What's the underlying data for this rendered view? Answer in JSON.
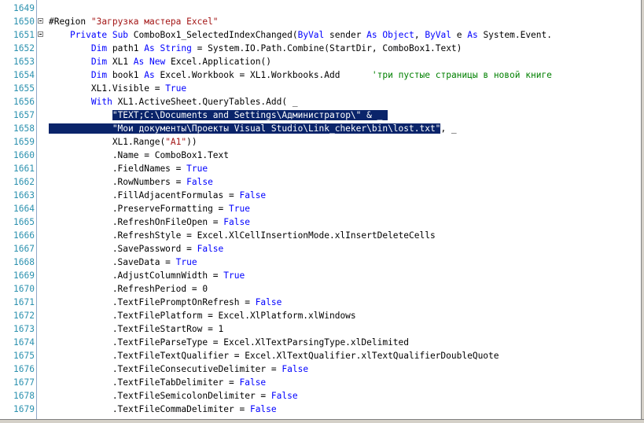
{
  "lines": [
    {
      "n": "1649",
      "t": ""
    },
    {
      "n": "1650",
      "fold": "open",
      "html": "#Region <span class=\"str\">\"Загрузка мастера Excel\"</span>"
    },
    {
      "n": "1651",
      "fold": "open",
      "html": "    <span class=\"kw\">Private Sub</span> ComboBox1_SelectedIndexChanged(<span class=\"kw\">ByVal</span> sender <span class=\"kw\">As</span> <span class=\"kw\">Object</span>, <span class=\"kw\">ByVal</span> e <span class=\"kw\">As</span> System.Event."
    },
    {
      "n": "1652",
      "html": "        <span class=\"kw\">Dim</span> path1 <span class=\"kw\">As String</span> = System.IO.Path.Combine(StartDir, ComboBox1.Text)"
    },
    {
      "n": "1653",
      "html": "        <span class=\"kw\">Dim</span> XL1 <span class=\"kw\">As New</span> Excel.Application()"
    },
    {
      "n": "1654",
      "html": "        <span class=\"kw\">Dim</span> book1 <span class=\"kw\">As</span> Excel.Workbook = XL1.Workbooks.Add      <span class=\"cmt\">'три пустые страницы в новой книге</span>"
    },
    {
      "n": "1655",
      "html": "        XL1.Visible = <span class=\"kw\">True</span>"
    },
    {
      "n": "1656",
      "html": "        <span class=\"kw\">With</span> XL1.ActiveSheet.QueryTables.Add( _"
    },
    {
      "n": "1657",
      "html": "            <span class=\"sel\">\"TEXT;C:\\Documents and Settings\\Администратор\\\" &amp; _ </span>"
    },
    {
      "n": "1658",
      "html": "<span class=\"sel\">            \"Мои документы\\Проекты Visual Studio\\Link_cheker\\bin\\lost.txt\"</span>, _"
    },
    {
      "n": "1659",
      "html": "            XL1.Range(<span class=\"str\">\"A1\"</span>))"
    },
    {
      "n": "1660",
      "html": "            .Name = ComboBox1.Text"
    },
    {
      "n": "1661",
      "html": "            .FieldNames = <span class=\"kw\">True</span>"
    },
    {
      "n": "1662",
      "html": "            .RowNumbers = <span class=\"kw\">False</span>"
    },
    {
      "n": "1663",
      "html": "            .FillAdjacentFormulas = <span class=\"kw\">False</span>"
    },
    {
      "n": "1664",
      "html": "            .PreserveFormatting = <span class=\"kw\">True</span>"
    },
    {
      "n": "1665",
      "html": "            .RefreshOnFileOpen = <span class=\"kw\">False</span>"
    },
    {
      "n": "1666",
      "html": "            .RefreshStyle = Excel.XlCellInsertionMode.xlInsertDeleteCells"
    },
    {
      "n": "1667",
      "html": "            .SavePassword = <span class=\"kw\">False</span>"
    },
    {
      "n": "1668",
      "html": "            .SaveData = <span class=\"kw\">True</span>"
    },
    {
      "n": "1669",
      "html": "            .AdjustColumnWidth = <span class=\"kw\">True</span>"
    },
    {
      "n": "1670",
      "html": "            .RefreshPeriod = 0"
    },
    {
      "n": "1671",
      "html": "            .TextFilePromptOnRefresh = <span class=\"kw\">False</span>"
    },
    {
      "n": "1672",
      "html": "            .TextFilePlatform = Excel.XlPlatform.xlWindows"
    },
    {
      "n": "1673",
      "html": "            .TextFileStartRow = 1"
    },
    {
      "n": "1674",
      "html": "            .TextFileParseType = Excel.XlTextParsingType.xlDelimited"
    },
    {
      "n": "1675",
      "html": "            .TextFileTextQualifier = Excel.XlTextQualifier.xlTextQualifierDoubleQuote"
    },
    {
      "n": "1676",
      "html": "            .TextFileConsecutiveDelimiter = <span class=\"kw\">False</span>"
    },
    {
      "n": "1677",
      "html": "            .TextFileTabDelimiter = <span class=\"kw\">False</span>"
    },
    {
      "n": "1678",
      "html": "            .TextFileSemicolonDelimiter = <span class=\"kw\">False</span>"
    },
    {
      "n": "1679",
      "html": "            .TextFileCommaDelimiter = <span class=\"kw\">False</span>"
    }
  ],
  "colors": {
    "keyword": "#0000ff",
    "string": "#a31515",
    "comment": "#008000",
    "selection": "#0a246a",
    "line_number": "#2b91af"
  }
}
